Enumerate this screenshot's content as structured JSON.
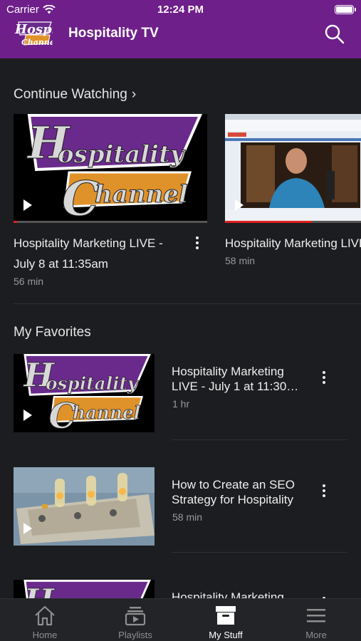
{
  "status_bar": {
    "carrier": "Carrier",
    "time": "12:24 PM"
  },
  "header": {
    "title": "Hospitality TV",
    "logo_text_1": "Hospitality",
    "logo_text_2": "Channel",
    "search_icon": "search-icon"
  },
  "continue_watching": {
    "heading": "Continue Watching",
    "items": [
      {
        "title": "Hospitality Marketing LIVE - July 8 at 11:35am",
        "duration": "56 min",
        "progress": 0.02
      },
      {
        "title": "Hospitality Marketing LIVE - What does It take to go t",
        "duration": "58 min",
        "progress": 0.45
      }
    ]
  },
  "my_favorites": {
    "heading": "My Favorites",
    "items": [
      {
        "title": "Hospitality Marketing LIVE - July 1 at 11:30…",
        "duration": "1 hr"
      },
      {
        "title": "How to Create an SEO Strategy for Hospitality",
        "duration": "58 min"
      },
      {
        "title": "Hospitality Marketing",
        "duration": ""
      }
    ]
  },
  "tabs": [
    {
      "label": "Home",
      "icon": "home-icon",
      "active": false
    },
    {
      "label": "Playlists",
      "icon": "playlists-icon",
      "active": false
    },
    {
      "label": "My Stuff",
      "icon": "my-stuff-icon",
      "active": true
    },
    {
      "label": "More",
      "icon": "menu-icon",
      "active": false
    }
  ],
  "colors": {
    "header": "#6e1f8a",
    "background": "#1b1d20",
    "progress": "#e02020",
    "logo_purple": "#6a2a8c",
    "logo_orange": "#e0922a"
  }
}
